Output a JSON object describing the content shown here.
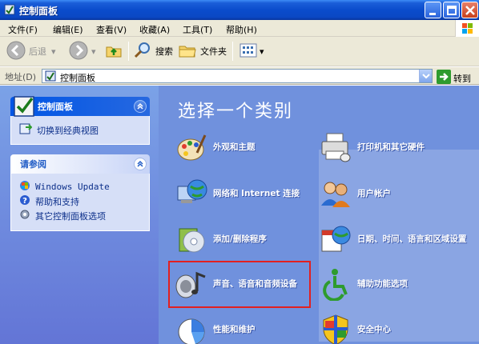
{
  "window": {
    "title": "控制面板"
  },
  "menu": [
    "文件(F)",
    "编辑(E)",
    "查看(V)",
    "收藏(A)",
    "工具(T)",
    "帮助(H)"
  ],
  "toolbar": {
    "back_label": "后退",
    "search_label": "搜索",
    "folders_label": "文件夹"
  },
  "address": {
    "label": "地址(D)",
    "value": "控制面板",
    "go_label": "转到"
  },
  "left_panel": {
    "control_panel_title": "控制面板",
    "switch_view_label": "切换到经典视图",
    "see_also_title": "请参阅",
    "see_also_items": [
      "Windows Update",
      "帮助和支持",
      "其它控制面板选项"
    ]
  },
  "main": {
    "title": "选择一个类别",
    "categories": [
      "外观和主题",
      "打印机和其它硬件",
      "网络和 Internet 连接",
      "用户帐户",
      "添加/删除程序",
      "日期、时间、语言和区域设置",
      "声音、语音和音频设备",
      "辅助功能选项",
      "性能和维护",
      "安全中心"
    ]
  },
  "colors": {
    "titlebar": "#0a4ccc",
    "left_pane": "#7ba2e7",
    "main_pane": "#7091dd",
    "highlight": "#e22020"
  }
}
